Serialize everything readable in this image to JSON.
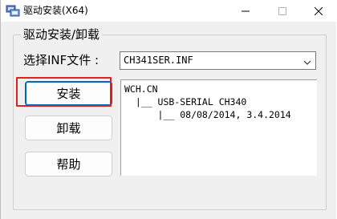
{
  "window": {
    "title": "驱动安装(X64)"
  },
  "group": {
    "label": "驱动安装/卸载"
  },
  "inf": {
    "label": "选择INF文件 :",
    "selected": "CH341SER.INF"
  },
  "buttons": {
    "install": "安装",
    "uninstall": "卸载",
    "help": "帮助"
  },
  "info": {
    "lines": [
      "WCH.CN",
      "  |__ USB-SERIAL CH340",
      "      |__ 08/08/2014, 3.4.2014"
    ]
  },
  "colors": {
    "highlight": "#e0201f",
    "focus_border": "#0067c0"
  },
  "icons": {
    "app": "driver-install-icon",
    "minimize": "minimize-icon",
    "maximize": "maximize-icon",
    "close": "close-icon",
    "dropdown": "chevron-down-icon"
  }
}
